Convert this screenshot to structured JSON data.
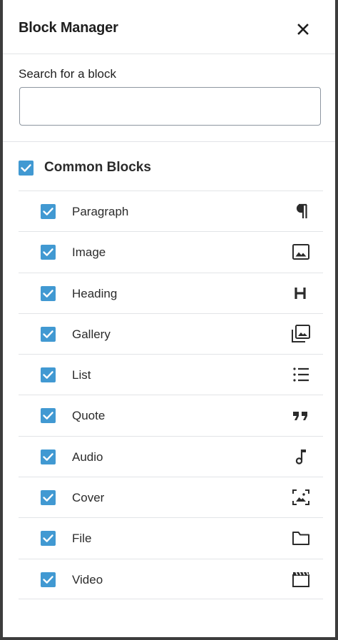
{
  "modal": {
    "title": "Block Manager",
    "close_label": "Close"
  },
  "search": {
    "label": "Search for a block",
    "value": "",
    "placeholder": ""
  },
  "category": {
    "label": "Common Blocks",
    "checked": true
  },
  "colors": {
    "checkbox": "#4199d2",
    "text": "#2b2b2b",
    "divider": "#e2e4e7"
  },
  "blocks": [
    {
      "label": "Paragraph",
      "icon": "paragraph-icon",
      "checked": true
    },
    {
      "label": "Image",
      "icon": "image-icon",
      "checked": true
    },
    {
      "label": "Heading",
      "icon": "heading-icon",
      "checked": true
    },
    {
      "label": "Gallery",
      "icon": "gallery-icon",
      "checked": true
    },
    {
      "label": "List",
      "icon": "list-icon",
      "checked": true
    },
    {
      "label": "Quote",
      "icon": "quote-icon",
      "checked": true
    },
    {
      "label": "Audio",
      "icon": "audio-icon",
      "checked": true
    },
    {
      "label": "Cover",
      "icon": "cover-icon",
      "checked": true
    },
    {
      "label": "File",
      "icon": "file-icon",
      "checked": true
    },
    {
      "label": "Video",
      "icon": "video-icon",
      "checked": true
    }
  ]
}
